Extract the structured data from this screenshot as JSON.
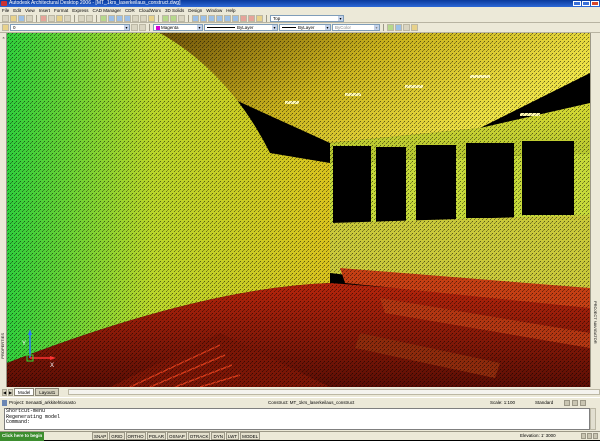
{
  "window": {
    "title": "Autodesk Architectural Desktop 2006 - [MT_1krs_laserkeilaus_construct.dwg]"
  },
  "menu": [
    "File",
    "Edit",
    "View",
    "Insert",
    "Format",
    "Express",
    "CAD Manager",
    "CDR",
    "CloudWorx",
    "3D Solids",
    "Design",
    "Window",
    "Help"
  ],
  "toolbar": {
    "layer_value": "0",
    "color_value": "Magenta",
    "linetype_value": "ByLayer",
    "lineweight_value": "ByLayer",
    "plotstyle_value": "ByColor",
    "view_value": "Top"
  },
  "palettes": {
    "left_label": "PROPERTIES",
    "right_label": "PROJECT NAVIGATOR",
    "close_glyph": "×"
  },
  "layout_tabs": [
    {
      "label": "Model",
      "active": true
    },
    {
      "label": "Layout1",
      "active": false
    }
  ],
  "nav_glyphs": [
    "◀",
    "▶"
  ],
  "project_bar": {
    "project": "Project: Senaatti_arkkitehtiosasto",
    "construct": "Construct: MT_1krs_laserkeilaus_construct",
    "scale": "Scale: 1:100",
    "standard": "Standard"
  },
  "command": {
    "lines": [
      "Shortcut-menu",
      "Regenerating model",
      "Command:"
    ]
  },
  "status": {
    "start_label": "Click here to begin",
    "modes": [
      "SNAP",
      "GRID",
      "ORTHO",
      "POLAR",
      "OSNAP",
      "OTRACK",
      "DYN",
      "LWT",
      "MODEL"
    ],
    "elevation": "Elevation: 1' 3000"
  },
  "ucs": {
    "x_label": "X",
    "y_label": "Y"
  },
  "colors": {
    "title_bar": "#1c4fbd",
    "chrome": "#ece9d8",
    "viewport_bg": "#000000",
    "point_hot": "#ff2200",
    "point_warm": "#ffee22",
    "point_cool": "#22dd55"
  },
  "icons": [
    "app-icon",
    "minimize-icon",
    "maximize-icon",
    "close-icon",
    "layer-icon",
    "ucs-icon",
    "project-icon"
  ]
}
